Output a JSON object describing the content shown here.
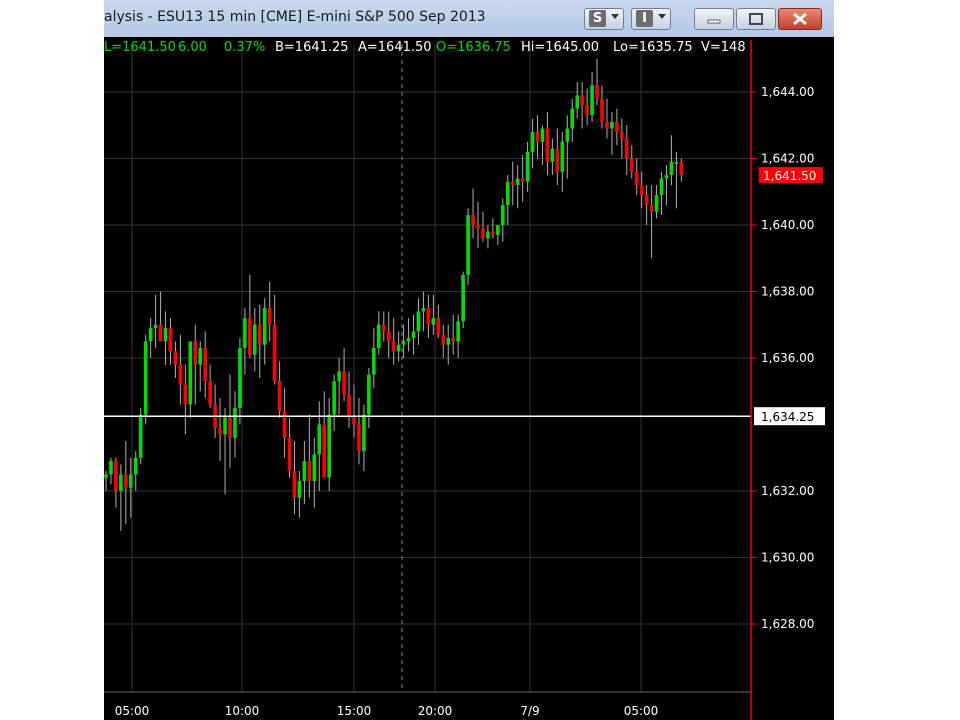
{
  "window": {
    "title": "alysis - ESU13 15 min [CME] E-mini S&P 500 Sep 2013",
    "s_button_label": "S",
    "i_button_label": "I",
    "minimize_glyph": "minimize-icon",
    "maximize_glyph": "maximize-icon",
    "close_glyph": "close-icon"
  },
  "info_bar": {
    "last": "L=1641.50",
    "change": "6.00",
    "pct_change": "0.37%",
    "bid": "B=1641.25",
    "ask": "A=1641.50",
    "open": "O=1636.75",
    "high": "Hi=1645.00",
    "low": "Lo=1635.75",
    "volume": "V=148"
  },
  "colors": {
    "up": "#00dd00",
    "down": "#ff0000",
    "background": "#000000",
    "grid": "#333333",
    "wick": "#b0b0b0",
    "axis_line": "#ff0000",
    "last_price_bg": "#ff0000",
    "crosshair": "#ffffff"
  },
  "chart_data": {
    "type": "candlestick",
    "ylim": [
      1626.0,
      1646.0
    ],
    "price_ticks": [
      "1,644.00",
      "1,642.00",
      "1,640.00",
      "1,638.00",
      "1,636.00",
      "1,632.00",
      "1,630.00",
      "1,628.00"
    ],
    "time_ticks": [
      "05:00",
      "10:00",
      "15:00",
      "20:00",
      "7/9",
      "05:00"
    ],
    "last_price_label": "1,641.50",
    "crosshair_price_label": "1,634.25",
    "last_price": 1641.5,
    "crosshair_price": 1634.25,
    "bars": [
      [
        1632.4,
        1632.6,
        1632.0,
        1632.5
      ],
      [
        1632.5,
        1633.0,
        1632.2,
        1632.9
      ],
      [
        1632.9,
        1633.0,
        1631.5,
        1632.0
      ],
      [
        1632.0,
        1632.8,
        1630.8,
        1632.5
      ],
      [
        1632.5,
        1633.5,
        1631.0,
        1632.1
      ],
      [
        1632.1,
        1633.0,
        1631.2,
        1632.5
      ],
      [
        1632.5,
        1633.2,
        1632.0,
        1633.0
      ],
      [
        1633.0,
        1634.5,
        1632.8,
        1634.3
      ],
      [
        1634.3,
        1636.7,
        1634.0,
        1636.5
      ],
      [
        1636.5,
        1637.2,
        1636.0,
        1636.9
      ],
      [
        1636.9,
        1637.9,
        1636.3,
        1637.0
      ],
      [
        1637.0,
        1638.0,
        1636.5,
        1636.5
      ],
      [
        1636.5,
        1637.4,
        1635.8,
        1636.9
      ],
      [
        1636.9,
        1637.2,
        1635.8,
        1636.2
      ],
      [
        1636.2,
        1636.5,
        1635.4,
        1635.8
      ],
      [
        1635.8,
        1636.7,
        1634.6,
        1635.2
      ],
      [
        1635.2,
        1635.8,
        1633.7,
        1634.6
      ],
      [
        1634.6,
        1635.8,
        1634.2,
        1636.5
      ],
      [
        1636.5,
        1637.0,
        1634.6,
        1635.8
      ],
      [
        1635.8,
        1636.5,
        1635.0,
        1636.3
      ],
      [
        1636.3,
        1636.8,
        1634.8,
        1635.3
      ],
      [
        1635.3,
        1635.8,
        1634.5,
        1634.6
      ],
      [
        1634.6,
        1635.2,
        1633.6,
        1633.9
      ],
      [
        1633.9,
        1634.8,
        1632.9,
        1633.7
      ],
      [
        1633.7,
        1634.5,
        1631.9,
        1634.2
      ],
      [
        1634.2,
        1635.5,
        1632.7,
        1633.6
      ],
      [
        1633.6,
        1635.0,
        1633.0,
        1634.5
      ],
      [
        1634.5,
        1636.6,
        1634.0,
        1636.3
      ],
      [
        1636.3,
        1637.5,
        1635.5,
        1637.2
      ],
      [
        1637.2,
        1638.5,
        1636.0,
        1636.1
      ],
      [
        1636.1,
        1637.5,
        1635.6,
        1637.0
      ],
      [
        1637.0,
        1637.6,
        1635.4,
        1636.4
      ],
      [
        1636.4,
        1637.8,
        1635.8,
        1637.5
      ],
      [
        1637.5,
        1638.3,
        1636.5,
        1637.0
      ],
      [
        1637.0,
        1637.9,
        1635.2,
        1635.3
      ],
      [
        1635.3,
        1635.9,
        1634.2,
        1634.4
      ],
      [
        1634.4,
        1635.1,
        1633.0,
        1633.6
      ],
      [
        1633.6,
        1634.2,
        1632.4,
        1632.6
      ],
      [
        1632.6,
        1633.5,
        1631.3,
        1631.8
      ],
      [
        1631.8,
        1632.6,
        1631.2,
        1632.3
      ],
      [
        1632.3,
        1633.5,
        1631.6,
        1632.9
      ],
      [
        1632.9,
        1634.3,
        1631.8,
        1632.3
      ],
      [
        1632.3,
        1633.6,
        1631.5,
        1633.1
      ],
      [
        1633.1,
        1634.7,
        1632.0,
        1634.0
      ],
      [
        1634.0,
        1635.0,
        1632.6,
        1632.4
      ],
      [
        1632.4,
        1634.8,
        1632.0,
        1634.3
      ],
      [
        1634.3,
        1635.5,
        1633.8,
        1635.3
      ],
      [
        1635.3,
        1636.0,
        1634.3,
        1635.6
      ],
      [
        1635.6,
        1636.3,
        1634.7,
        1634.9
      ],
      [
        1634.9,
        1635.6,
        1633.9,
        1634.2
      ],
      [
        1634.2,
        1635.2,
        1633.6,
        1634.0
      ],
      [
        1634.0,
        1634.8,
        1632.8,
        1633.2
      ],
      [
        1633.2,
        1634.6,
        1632.6,
        1634.3
      ],
      [
        1634.3,
        1635.7,
        1633.9,
        1635.5
      ],
      [
        1635.5,
        1636.9,
        1635.1,
        1636.3
      ],
      [
        1636.3,
        1637.4,
        1636.1,
        1637.0
      ],
      [
        1637.0,
        1637.4,
        1636.5,
        1636.8
      ],
      [
        1636.8,
        1637.4,
        1636.0,
        1636.5
      ],
      [
        1636.5,
        1637.2,
        1635.8,
        1636.2
      ],
      [
        1636.2,
        1636.8,
        1635.9,
        1636.4
      ],
      [
        1636.4,
        1637.0,
        1636.0,
        1636.5
      ],
      [
        1636.5,
        1637.2,
        1636.2,
        1636.6
      ],
      [
        1636.6,
        1637.3,
        1636.1,
        1636.8
      ],
      [
        1636.8,
        1637.8,
        1636.4,
        1637.4
      ],
      [
        1637.4,
        1638.0,
        1636.8,
        1637.5
      ],
      [
        1637.5,
        1637.9,
        1636.6,
        1637.0
      ],
      [
        1637.0,
        1637.9,
        1636.7,
        1637.2
      ],
      [
        1637.2,
        1637.6,
        1636.6,
        1636.7
      ],
      [
        1636.7,
        1637.0,
        1636.0,
        1636.4
      ],
      [
        1636.4,
        1637.0,
        1635.8,
        1636.6
      ],
      [
        1636.6,
        1637.3,
        1636.1,
        1636.5
      ],
      [
        1636.5,
        1637.3,
        1636.0,
        1637.1
      ],
      [
        1637.1,
        1638.6,
        1636.9,
        1638.5
      ],
      [
        1638.5,
        1640.5,
        1638.2,
        1640.3
      ],
      [
        1640.3,
        1641.1,
        1639.6,
        1640.0
      ],
      [
        1640.0,
        1640.7,
        1639.3,
        1639.9
      ],
      [
        1639.9,
        1640.4,
        1639.5,
        1639.6
      ],
      [
        1639.6,
        1640.0,
        1639.3,
        1639.8
      ],
      [
        1639.8,
        1640.2,
        1639.6,
        1639.7
      ],
      [
        1639.7,
        1640.0,
        1639.4,
        1640.0
      ],
      [
        1640.0,
        1640.8,
        1639.5,
        1640.6
      ],
      [
        1640.6,
        1641.5,
        1640.0,
        1641.3
      ],
      [
        1641.3,
        1641.9,
        1640.6,
        1641.2
      ],
      [
        1641.2,
        1641.8,
        1640.5,
        1641.4
      ],
      [
        1641.4,
        1642.1,
        1640.7,
        1641.3
      ],
      [
        1641.3,
        1642.5,
        1641.0,
        1642.2
      ],
      [
        1642.2,
        1643.2,
        1641.7,
        1642.8
      ],
      [
        1642.8,
        1643.3,
        1642.0,
        1642.5
      ],
      [
        1642.5,
        1643.0,
        1641.8,
        1642.9
      ],
      [
        1642.9,
        1643.4,
        1641.5,
        1641.9
      ],
      [
        1641.9,
        1642.6,
        1641.5,
        1642.3
      ],
      [
        1642.3,
        1642.9,
        1641.2,
        1641.6
      ],
      [
        1641.6,
        1642.8,
        1641.0,
        1642.5
      ],
      [
        1642.5,
        1643.3,
        1641.4,
        1642.9
      ],
      [
        1642.9,
        1643.8,
        1642.5,
        1643.5
      ],
      [
        1643.5,
        1644.3,
        1643.2,
        1643.9
      ],
      [
        1643.9,
        1644.3,
        1642.9,
        1643.6
      ],
      [
        1643.6,
        1644.1,
        1643.0,
        1643.3
      ],
      [
        1643.3,
        1644.6,
        1643.1,
        1644.2
      ],
      [
        1644.2,
        1645.0,
        1643.6,
        1643.8
      ],
      [
        1643.8,
        1644.2,
        1642.9,
        1643.1
      ],
      [
        1643.1,
        1643.8,
        1642.6,
        1642.9
      ],
      [
        1642.9,
        1643.4,
        1642.1,
        1643.1
      ],
      [
        1643.1,
        1643.5,
        1642.4,
        1642.8
      ],
      [
        1642.8,
        1643.2,
        1642.0,
        1642.6
      ],
      [
        1642.6,
        1643.0,
        1641.5,
        1642.0
      ],
      [
        1642.0,
        1642.4,
        1641.4,
        1641.6
      ],
      [
        1641.6,
        1642.0,
        1640.9,
        1641.2
      ],
      [
        1641.2,
        1641.6,
        1640.5,
        1640.9
      ],
      [
        1640.9,
        1641.2,
        1640.0,
        1640.6
      ],
      [
        1640.6,
        1641.2,
        1639.0,
        1640.4
      ],
      [
        1640.4,
        1641.2,
        1640.2,
        1640.9
      ],
      [
        1640.9,
        1641.6,
        1640.3,
        1641.4
      ],
      [
        1641.4,
        1641.8,
        1640.6,
        1641.5
      ],
      [
        1641.5,
        1642.7,
        1641.2,
        1641.9
      ],
      [
        1641.9,
        1642.2,
        1640.5,
        1641.9
      ],
      [
        1641.9,
        1642.0,
        1641.3,
        1641.5
      ]
    ]
  }
}
